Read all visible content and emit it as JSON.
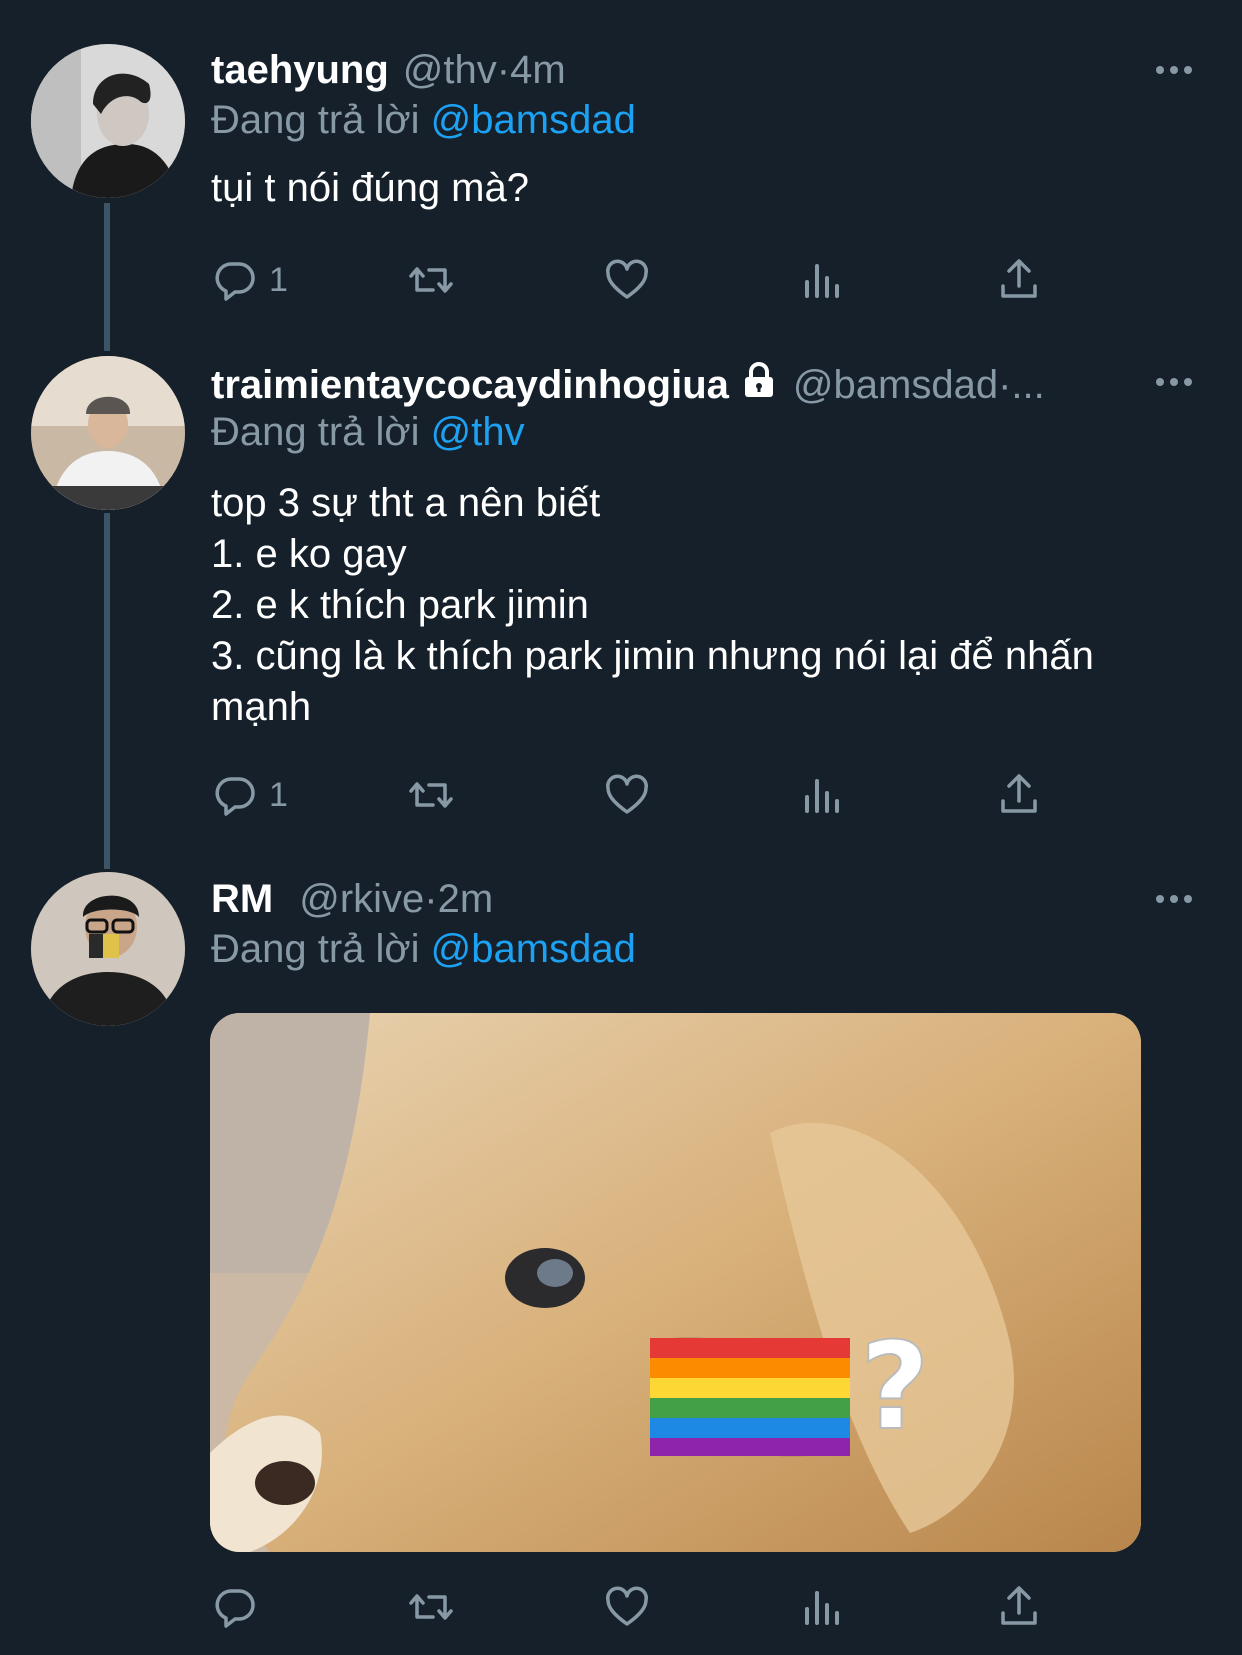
{
  "tweets": [
    {
      "name": "taehyung",
      "handle": "@thv",
      "time_sep": " · ",
      "time": "4m",
      "reply_prefix": "Đang trả lời ",
      "reply_to": "@bamsdad",
      "lines": [
        "tụi t nói đúng mà?"
      ],
      "reply_count": "1"
    },
    {
      "name": "traimientaycocaydinhogiua",
      "handle": "@bamsdad",
      "time_sep": " · ",
      "time": "...",
      "reply_prefix": "Đang trả lời ",
      "reply_to": "@thv",
      "lines": [
        "top 3 sự tht a nên biết",
        "1. e ko gay",
        "2. e k thích park jimin",
        "3. cũng là k thích park jimin nhưng nói lại để nhấn",
        "mạnh"
      ],
      "reply_count": "1"
    },
    {
      "name": "RM",
      "handle": "@rkive",
      "time_sep": " · ",
      "time": "2m",
      "reply_prefix": "Đang trả lời ",
      "reply_to": "@bamsdad",
      "lines": [],
      "reply_count": "",
      "media_text": "?"
    }
  ],
  "icons": {
    "reply": "reply-icon",
    "retweet": "retweet-icon",
    "like": "heart-icon",
    "analytics": "analytics-icon",
    "share": "share-icon",
    "more": "more-icon",
    "lock": "lock-icon"
  },
  "colors": {
    "background": "#15202b",
    "secondary_text": "#8899a6",
    "link": "#1da1f2",
    "thread_line": "#3d5466"
  }
}
